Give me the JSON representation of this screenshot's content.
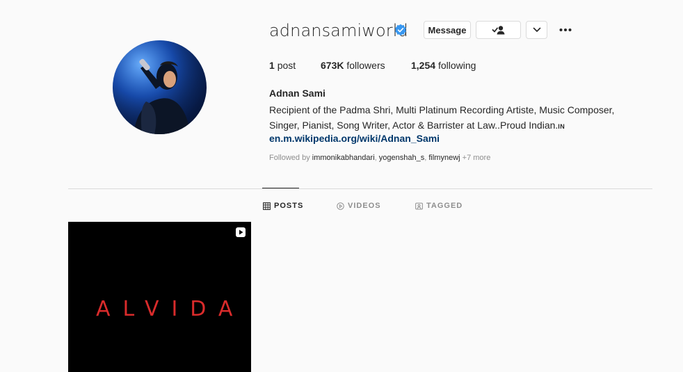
{
  "profile": {
    "username": "adnansamiworld",
    "full_name": "Adnan Sami",
    "bio": "Recipient of the Padma Shri, Multi Platinum Recording Artiste, Music Composer, Singer, Pianist, Song Writer, Actor & Barrister at Law..Proud Indian.",
    "bio_flag": "IN",
    "link": "en.m.wikipedia.org/wiki/Adnan_Sami",
    "followed_by_prefix": "Followed by ",
    "followed_by_users": [
      "immonikabhandari",
      "yogenshah_s",
      "filmynewj"
    ],
    "followed_by_more": "+7 more"
  },
  "actions": {
    "message_label": "Message",
    "follow_icon": "person-check-icon",
    "dropdown_icon": "chevron-down-icon",
    "more_icon": "more-options-icon"
  },
  "stats": {
    "posts_count": "1",
    "posts_label": "post",
    "followers_count": "673K",
    "followers_label": "followers",
    "following_count": "1,254",
    "following_label": "following"
  },
  "tabs": [
    {
      "label": "POSTS",
      "icon": "grid-icon",
      "active": true
    },
    {
      "label": "VIDEOS",
      "icon": "play-circle-icon",
      "active": false
    },
    {
      "label": "TAGGED",
      "icon": "tag-person-icon",
      "active": false
    }
  ],
  "posts": [
    {
      "title": "ALVIDA",
      "type": "video",
      "title_color": "#d92b2b"
    }
  ],
  "colors": {
    "verified": "#3897f0",
    "link": "#00376b",
    "muted": "#8e8e8e",
    "background": "#fafafa"
  }
}
